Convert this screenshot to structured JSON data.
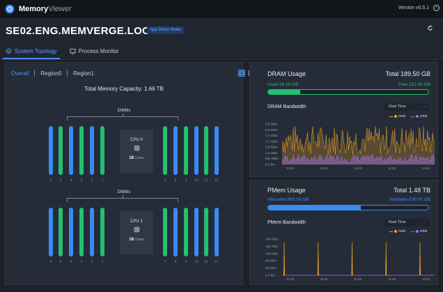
{
  "app": {
    "name_bold": "Memory",
    "name_light": "Viewer",
    "version": "Version v0.5.1"
  },
  "header": {
    "host": "SE02.ENG.MEMVERGE.LOCAL",
    "mode": "App Direct Mode",
    "tabs": [
      {
        "label": "System Topology",
        "active": true
      },
      {
        "label": "Process Monitor",
        "active": false
      }
    ]
  },
  "topology": {
    "region_tabs": [
      "Overall",
      "Region0",
      "Region1"
    ],
    "total_capacity": "Total Memory Capacity: 1.66 TB",
    "sockets": [
      {
        "dimms_label": "DIMMs",
        "left_slots": [
          {
            "num": "6",
            "color": "blue"
          },
          {
            "num": "5",
            "color": "green"
          },
          {
            "num": "4",
            "color": "blue"
          },
          {
            "num": "3",
            "color": "green"
          },
          {
            "num": "2",
            "color": "blue"
          },
          {
            "num": "1",
            "color": "green"
          }
        ],
        "right_slots": [
          {
            "num": "7",
            "color": "green"
          },
          {
            "num": "8",
            "color": "blue"
          },
          {
            "num": "9",
            "color": "green"
          },
          {
            "num": "10",
            "color": "blue"
          },
          {
            "num": "11",
            "color": "green"
          },
          {
            "num": "12",
            "color": "blue"
          }
        ],
        "cpu": {
          "name": "CPU 0",
          "cores_num": "18",
          "cores_label": "Cores"
        }
      },
      {
        "dimms_label": "DIMMs",
        "left_slots": [
          {
            "num": "6",
            "color": "blue"
          },
          {
            "num": "5",
            "color": "green"
          },
          {
            "num": "4",
            "color": "blue"
          },
          {
            "num": "3",
            "color": "green"
          },
          {
            "num": "2",
            "color": "blue"
          },
          {
            "num": "1",
            "color": "green"
          }
        ],
        "right_slots": [
          {
            "num": "7",
            "color": "green"
          },
          {
            "num": "8",
            "color": "blue"
          },
          {
            "num": "9",
            "color": "green"
          },
          {
            "num": "10",
            "color": "blue"
          },
          {
            "num": "11",
            "color": "green"
          },
          {
            "num": "12",
            "color": "blue"
          }
        ],
        "cpu": {
          "name": "CPU 1",
          "cores_num": "18",
          "cores_label": "Cores"
        }
      }
    ]
  },
  "dram": {
    "title": "DRAM Usage",
    "total": "Total 189.50 GB",
    "used": "Used 38.10 GB",
    "free": "Free 151.40 GB",
    "used_fraction": 0.2,
    "bandwidth_title": "DRAM Bandwidth",
    "range": "Real Time"
  },
  "pmem": {
    "title": "PMem Usage",
    "total": "Total 1.48 TB",
    "allocated": "Allocated 882.00 GB",
    "available": "Available 630.00 GB",
    "used_fraction": 0.58,
    "bandwidth_title": "PMem Bandwidth",
    "range": "Real Time"
  },
  "legend": {
    "read": "read",
    "write": "write"
  },
  "colors": {
    "blue": "#3a8bf4",
    "green": "#22c172",
    "read": "#f5a623",
    "write": "#a06ef0",
    "accent": "#4f8df5"
  },
  "chart_data": [
    {
      "type": "line",
      "title": "DRAM Bandwidth",
      "y_ticks": [
        "0.0 B/s",
        "954 MB/s",
        "1.9 GB/s",
        "2.8 GB/s",
        "3.7 GB/s",
        "4.7 GB/s",
        "5.6 GB/s",
        "6.5 GB/s"
      ],
      "x_ticks": [
        "11:20",
        "11:21",
        "11:22",
        "11:23",
        "11:24"
      ],
      "series": [
        {
          "name": "read",
          "description": "highly variable, ~1.5–6.3 GB/s"
        },
        {
          "name": "write",
          "description": "~0.3–1.6 GB/s"
        }
      ]
    },
    {
      "type": "line",
      "title": "PMem Bandwidth",
      "y_ticks": [
        "0.0 B/s",
        "49 KB/s",
        "98 KB/s",
        "146 KB/s",
        "195 KB/s",
        "244 KB/s"
      ],
      "x_ticks": [
        "11:20",
        "11:21",
        "11:22",
        "11:23",
        "11:24"
      ],
      "series": [
        {
          "name": "read",
          "spike_times": [
            "11:19:50",
            "11:20:50",
            "11:21:50",
            "11:22:50",
            "11:23:50"
          ],
          "spike_value_kbs": 225,
          "baseline": 0
        },
        {
          "name": "write",
          "baseline": 0
        }
      ]
    }
  ]
}
